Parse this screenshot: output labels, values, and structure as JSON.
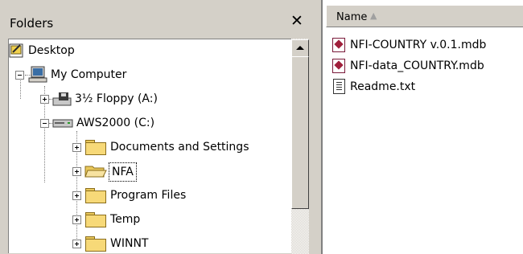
{
  "folders_pane": {
    "title": "Folders",
    "close": "✕",
    "tree": [
      {
        "label": "Desktop",
        "icon": "desktop-icon",
        "expander": "none",
        "level": 0
      },
      {
        "label": "My Computer",
        "icon": "my-computer-icon",
        "expander": "minus",
        "level": 1
      },
      {
        "label": "3½ Floppy (A:)",
        "icon": "floppy-drive-icon",
        "expander": "plus",
        "level": 2
      },
      {
        "label": "AWS2000 (C:)",
        "icon": "hard-drive-icon",
        "expander": "minus",
        "level": 2
      },
      {
        "label": "Documents and Settings",
        "icon": "folder-icon",
        "expander": "plus",
        "level": 3
      },
      {
        "label": "NFA",
        "icon": "folder-open-icon",
        "expander": "plus",
        "level": 3,
        "selected": true
      },
      {
        "label": "Program Files",
        "icon": "folder-icon",
        "expander": "plus",
        "level": 3
      },
      {
        "label": "Temp",
        "icon": "folder-icon",
        "expander": "plus",
        "level": 3
      },
      {
        "label": "WINNT",
        "icon": "folder-icon",
        "expander": "plus",
        "level": 3
      }
    ]
  },
  "file_pane": {
    "column_header": "Name",
    "sort_indicator": "▲",
    "files": [
      {
        "label": "NFI-COUNTRY v.0.1.mdb",
        "icon": "access-database-icon"
      },
      {
        "label": "NFI-data_COUNTRY.mdb",
        "icon": "access-database-icon"
      },
      {
        "label": "Readme.txt",
        "icon": "text-file-icon"
      }
    ]
  }
}
